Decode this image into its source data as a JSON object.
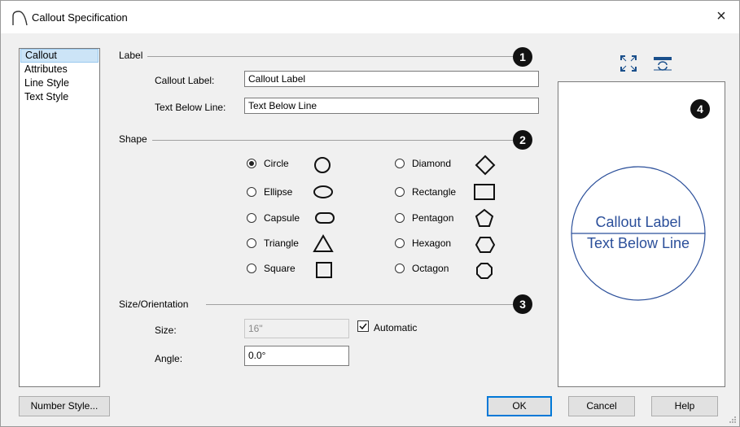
{
  "window": {
    "title": "Callout Specification",
    "close_glyph": "×"
  },
  "nav": {
    "items": [
      "Callout",
      "Attributes",
      "Line Style",
      "Text Style"
    ],
    "selected": 0
  },
  "groups": {
    "label": "Label",
    "shape": "Shape",
    "size": "Size/Orientation"
  },
  "badges": [
    "1",
    "2",
    "3",
    "4"
  ],
  "label_fields": {
    "callout_label": {
      "label": "Callout Label:",
      "value": "Callout Label"
    },
    "text_below": {
      "label": "Text Below Line:",
      "value": "Text Below Line"
    }
  },
  "shapes": {
    "left": [
      "Circle",
      "Ellipse",
      "Capsule",
      "Triangle",
      "Square"
    ],
    "right": [
      "Diamond",
      "Rectangle",
      "Pentagon",
      "Hexagon",
      "Octagon"
    ],
    "selected": "Circle"
  },
  "size": {
    "label": "Size:",
    "value": "16\"",
    "automatic_label": "Automatic",
    "automatic": true
  },
  "angle": {
    "label": "Angle:",
    "value": "0.0°"
  },
  "preview": {
    "callout_label": "Callout Label",
    "text_below": "Text Below Line"
  },
  "buttons": {
    "number_style": "Number Style...",
    "ok": "OK",
    "cancel": "Cancel",
    "help": "Help"
  },
  "colors": {
    "preview_blue": "#2b4f9a",
    "selection": "#cce4f7",
    "default_button_border": "#0078d7"
  }
}
